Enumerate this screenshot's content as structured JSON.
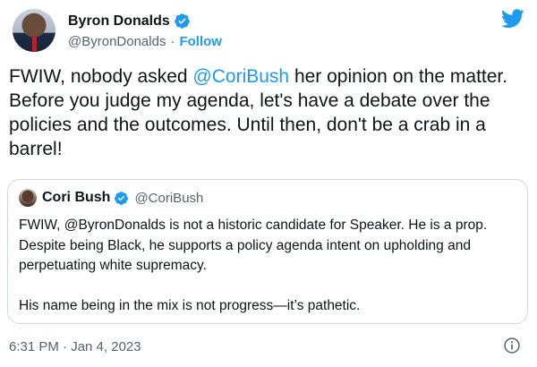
{
  "author": {
    "display_name": "Byron Donalds",
    "handle": "@ByronDonalds",
    "separator": "·",
    "follow_label": "Follow"
  },
  "tweet": {
    "text_before": "FWIW, nobody asked ",
    "mention": "@CoriBush",
    "text_after": " her opinion on the matter. Before you judge my agenda, let's have a debate over the policies and the outcomes. Until then, don't be a crab in a barrel!"
  },
  "quoted_tweet": {
    "display_name": "Cori Bush",
    "handle": "@CoriBush",
    "paragraph_1": "FWIW, @ByronDonalds is not a historic candidate for Speaker. He is a prop. Despite being Black, he supports a policy agenda intent on upholding and perpetuating white supremacy.",
    "paragraph_2": "His name being in the mix is not progress—it’s pathetic."
  },
  "footer": {
    "timestamp": "6:31 PM · Jan 4, 2023"
  },
  "icons": {
    "brand": "twitter-bird-icon",
    "verified": "verified-badge-icon",
    "info": "info-icon"
  },
  "colors": {
    "accent": "#1d9bf0",
    "text": "#0f1419",
    "secondary": "#536471",
    "border": "#cfd9de"
  }
}
